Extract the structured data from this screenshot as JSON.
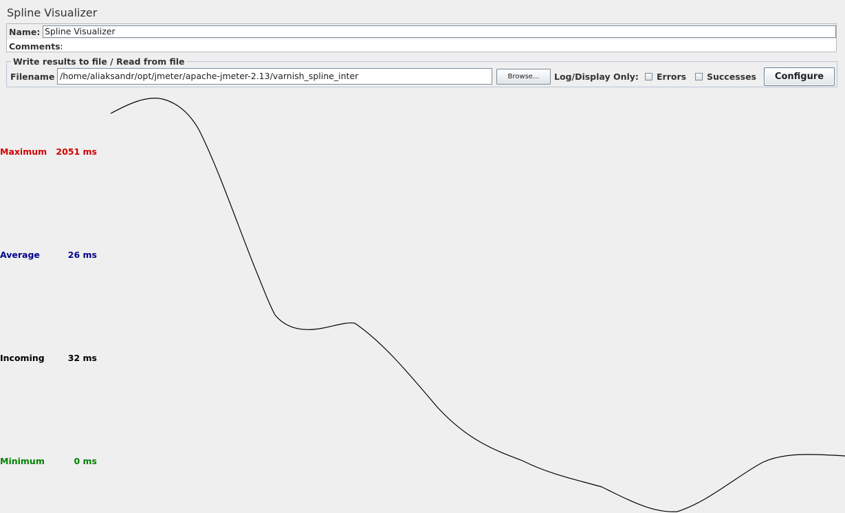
{
  "window": {
    "title": "Spline Visualizer"
  },
  "name_field": {
    "label": "Name:",
    "value": "Spline Visualizer"
  },
  "comments_field": {
    "label": "Comments:",
    "value": ""
  },
  "file_panel": {
    "legend": "Write results to file / Read from file",
    "filename_label": "Filename",
    "filename_value": "/home/aliaksandr/opt/jmeter/apache-jmeter-2.13/varnish_spline_inter",
    "browse_label": "Browse...",
    "log_display_label": "Log/Display Only:",
    "errors_label": "Errors",
    "errors_checked": false,
    "successes_label": "Successes",
    "successes_checked": false,
    "configure_label": "Configure"
  },
  "stats": [
    {
      "label": "Maximum",
      "value": "2051 ms",
      "color": "#d00000"
    },
    {
      "label": "Average",
      "value": "26 ms",
      "color": "#00008b"
    },
    {
      "label": "Incoming",
      "value": "32 ms",
      "color": "#000000"
    },
    {
      "label": "Minimum",
      "value": "0 ms",
      "color": "#008000"
    }
  ],
  "spline": {
    "stroke_color": "#000000"
  }
}
